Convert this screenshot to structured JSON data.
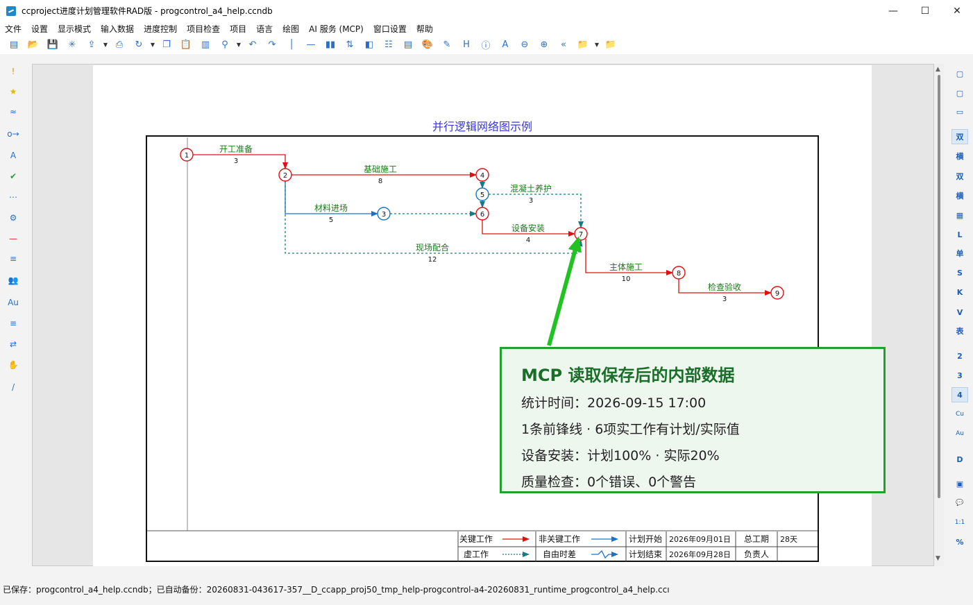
{
  "window": {
    "title": "ccproject进度计划管理软件RAD版 - progcontrol_a4_help.ccndb",
    "minimize": "—",
    "maximize": "☐",
    "close": "✕"
  },
  "menu": [
    "文件",
    "设置",
    "显示模式",
    "输入数据",
    "进度控制",
    "项目检查",
    "项目",
    "语言",
    "绘图",
    "AI 服务 (MCP)",
    "窗口设置",
    "帮助"
  ],
  "toolbar_icons": [
    "new-icon",
    "open-icon",
    "save-icon",
    "star-burst-icon",
    "export-icon",
    "dropdown",
    "print-icon",
    "refresh-icon",
    "dropdown",
    "copy-icon",
    "paste-icon",
    "save-alt-icon",
    "search-icon",
    "dropdown",
    "undo-icon",
    "redo-icon",
    "divider",
    "line-icon",
    "bars-icon",
    "sort-icon",
    "contrast-icon",
    "gantt-icon",
    "report-icon",
    "palette-icon",
    "edit-icon",
    "h-icon",
    "info-icon",
    "a-icon",
    "zoom-out-icon",
    "zoom-in-icon",
    "back-icon",
    "folder-icon",
    "dropdown",
    "folder-red-icon"
  ],
  "left_tools": [
    {
      "icon": "exclamation-icon",
      "glyph": "!",
      "color": "#f08a00"
    },
    {
      "icon": "star-icon",
      "glyph": "★",
      "color": "#e6b800"
    },
    {
      "icon": "wave-icon",
      "glyph": "≈",
      "color": "#2a6fc9"
    },
    {
      "icon": "link-icon",
      "glyph": "o→",
      "color": "#2a6fc9"
    },
    {
      "icon": "text-a-icon",
      "glyph": "A",
      "color": "#2a6fc9"
    },
    {
      "icon": "check-icon",
      "glyph": "✔",
      "color": "#2a9d3a"
    },
    {
      "icon": "dots-icon",
      "glyph": "⋯",
      "color": "#2a6fc9"
    },
    {
      "icon": "gear-icon",
      "glyph": "⚙",
      "color": "#2a6fc9"
    },
    {
      "icon": "minus-red-icon",
      "glyph": "—",
      "color": "#d22"
    },
    {
      "icon": "sort-lines-icon",
      "glyph": "≡",
      "color": "#2a6fc9"
    },
    {
      "icon": "people-icon",
      "glyph": "👥",
      "color": "#2a9d3a"
    },
    {
      "icon": "au-icon",
      "glyph": "Au",
      "color": "#2a6fc9"
    },
    {
      "icon": "filter-icon",
      "glyph": "≡",
      "color": "#2a6fc9"
    },
    {
      "icon": "swap-icon",
      "glyph": "⇄",
      "color": "#2a6fc9"
    },
    {
      "icon": "hand-icon",
      "glyph": "✋",
      "color": "#333"
    },
    {
      "icon": "wand-icon",
      "glyph": "/",
      "color": "#2a6fc9"
    }
  ],
  "right_tools": [
    {
      "icon": "panel-left-icon",
      "label": "▢",
      "sel": false
    },
    {
      "icon": "panel-right-icon",
      "label": "▢",
      "sel": false
    },
    {
      "icon": "panel-bottom-icon",
      "label": "▭",
      "sel": false
    },
    {
      "icon": "dual-icon",
      "label": "双",
      "sel": true
    },
    {
      "icon": "horizontal-icon",
      "label": "横",
      "sel": false
    },
    {
      "icon": "dual-plus-icon",
      "label": "双",
      "sel": false
    },
    {
      "icon": "horizontal-plus-icon",
      "label": "横",
      "sel": false
    },
    {
      "icon": "table-icon",
      "label": "▦",
      "sel": false
    },
    {
      "icon": "l-icon",
      "label": "L",
      "sel": false
    },
    {
      "icon": "single-icon",
      "label": "单",
      "sel": false
    },
    {
      "icon": "s-icon",
      "label": "S",
      "sel": false
    },
    {
      "icon": "k-icon",
      "label": "K",
      "sel": false
    },
    {
      "icon": "v-icon",
      "label": "V",
      "sel": false
    },
    {
      "icon": "table-text-icon",
      "label": "表",
      "sel": false
    },
    {
      "icon": "num-2-icon",
      "label": "2",
      "sel": false
    },
    {
      "icon": "num-3-icon",
      "label": "3",
      "sel": false
    },
    {
      "icon": "num-4-icon",
      "label": "4",
      "sel": true
    },
    {
      "icon": "cu-icon",
      "label": "Cu",
      "sel": false
    },
    {
      "icon": "au-icon",
      "label": "Au",
      "sel": false
    },
    {
      "icon": "d-icon",
      "label": "D",
      "sel": false
    },
    {
      "icon": "calendar-icon",
      "label": "▣",
      "sel": false
    },
    {
      "icon": "comment-icon",
      "label": "💬",
      "sel": false
    },
    {
      "icon": "ratio-icon",
      "label": "1:1",
      "sel": false
    },
    {
      "icon": "percent-icon",
      "label": "%",
      "sel": false
    }
  ],
  "diagram": {
    "title": "并行逻辑网络图示例",
    "nodes": [
      {
        "id": "1",
        "kind": "critical"
      },
      {
        "id": "2",
        "kind": "critical"
      },
      {
        "id": "3",
        "kind": "noncritical"
      },
      {
        "id": "4",
        "kind": "critical"
      },
      {
        "id": "5",
        "kind": "noncritical"
      },
      {
        "id": "6",
        "kind": "critical"
      },
      {
        "id": "7",
        "kind": "critical"
      },
      {
        "id": "8",
        "kind": "critical"
      },
      {
        "id": "9",
        "kind": "critical"
      }
    ],
    "activities": [
      {
        "name": "开工准备",
        "duration": "3",
        "from": "1",
        "to": "2",
        "type": "critical"
      },
      {
        "name": "基础施工",
        "duration": "8",
        "from": "2",
        "to": "4",
        "type": "critical"
      },
      {
        "name": "材料进场",
        "duration": "5",
        "from": "2",
        "to": "3",
        "type": "noncritical"
      },
      {
        "name": "混凝土养护",
        "duration": "3",
        "from": "5",
        "to": "7",
        "type": "float"
      },
      {
        "name": "设备安装",
        "duration": "4",
        "from": "6",
        "to": "7",
        "type": "critical"
      },
      {
        "name": "现场配合",
        "duration": "12",
        "from": "2",
        "to": "7",
        "type": "float"
      },
      {
        "name": "主体施工",
        "duration": "10",
        "from": "7",
        "to": "8",
        "type": "critical"
      },
      {
        "name": "检查验收",
        "duration": "3",
        "from": "8",
        "to": "9",
        "type": "critical"
      }
    ],
    "legend": {
      "critical": "关键工作",
      "noncritical": "非关键工作",
      "dummy": "虚工作",
      "free_float": "自由时差",
      "plan_start_label": "计划开始",
      "plan_start": "2026年09月01日",
      "plan_end_label": "计划结束",
      "plan_end": "2026年09月28日",
      "total_duration_label": "总工期",
      "total_duration": "28天",
      "owner_label": "负责人",
      "owner": ""
    }
  },
  "callout": {
    "title": "MCP 读取保存后的内部数据",
    "lines": [
      "统计时间：2026-09-15 17:00",
      "1条前锋线 · 6项实工作有计划/实际值",
      "设备安装：计划100% · 实际20%",
      "质量检查：0个错误、0个警告"
    ]
  },
  "status": "已保存：progcontrol_a4_help.ccndb；已自动备份：20260831-043617-357__D_ccapp_proj50_tmp_help-progcontrol-a4-20260831_runtime_progcontrol_a4_help.ccı",
  "colors": {
    "critical": "#e01010",
    "noncritical": "#1a73c8",
    "float": "#137b8a",
    "label": "#1a7a1a",
    "callout_border": "#1fa02f",
    "arrow": "#22c222"
  }
}
